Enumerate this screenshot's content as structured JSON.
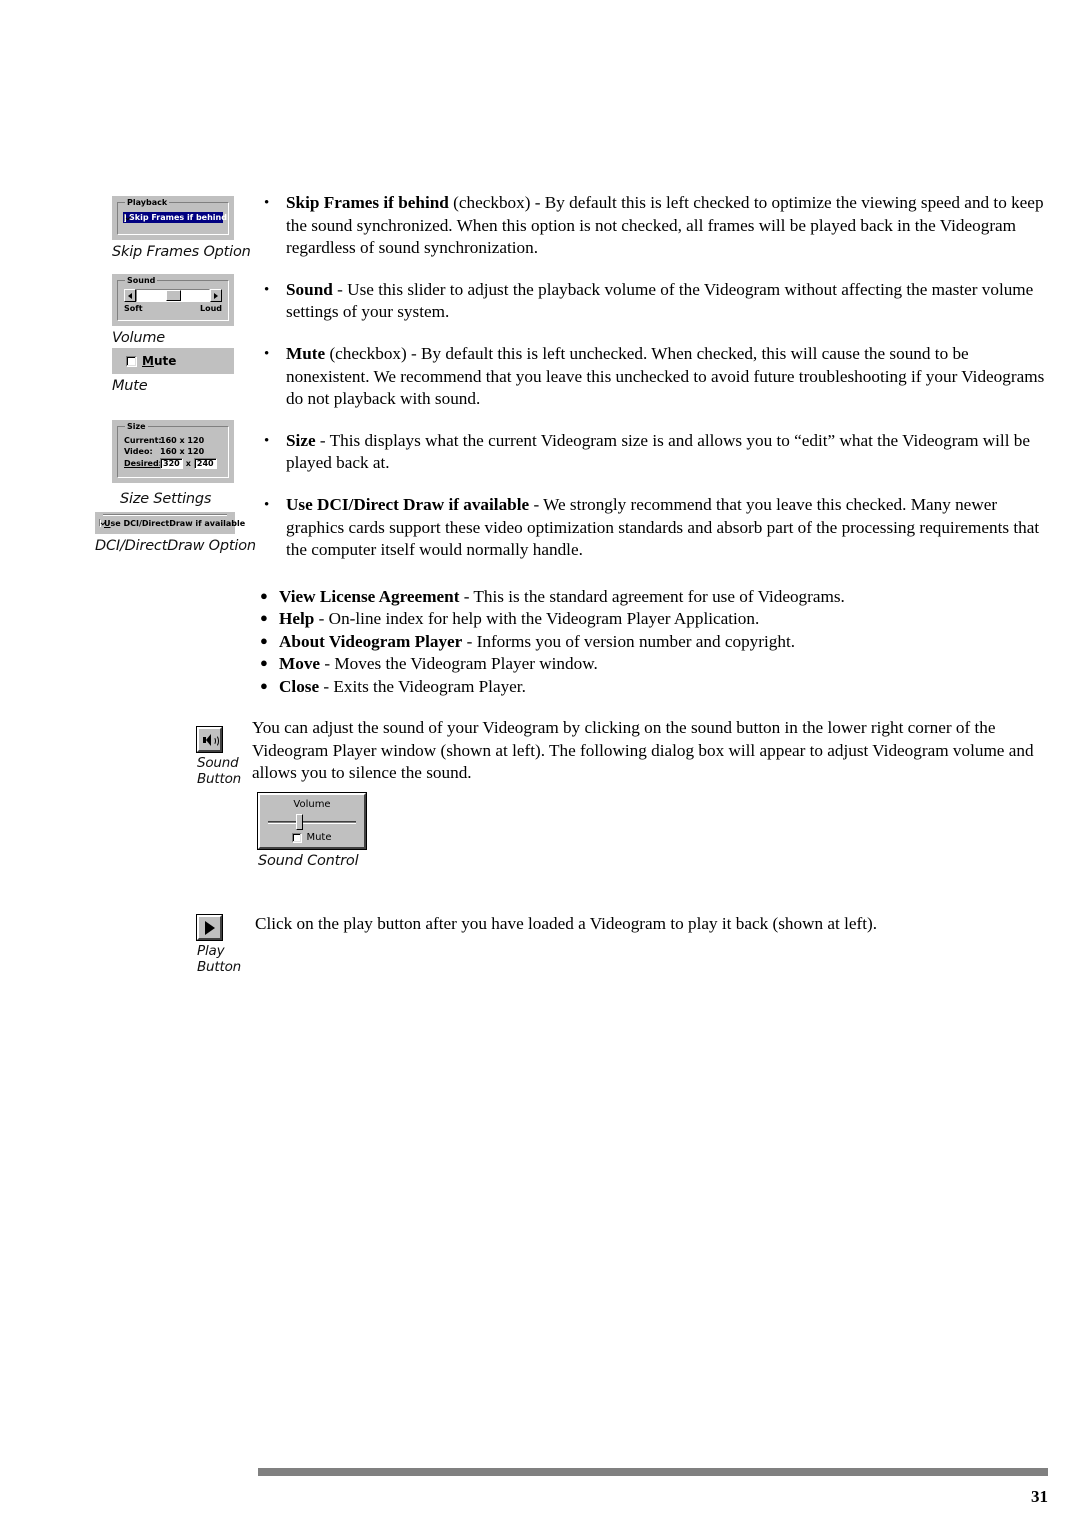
{
  "document": {
    "page_number": "31"
  },
  "figures": {
    "skip_frames": {
      "caption": "Skip Frames Option",
      "group_title": "Playback",
      "checkbox_label": "Skip Frames if behind",
      "checked": true,
      "highlight_color": "#000080"
    },
    "volume": {
      "caption": "Volume",
      "group_title": "Sound",
      "label_left": "Soft",
      "label_right": "Loud"
    },
    "mute": {
      "caption": "Mute",
      "checkbox_label_mnemonic": "M",
      "checkbox_label_rest": "ute",
      "checked": false
    },
    "size": {
      "caption": "Size Settings",
      "group_title": "Size",
      "rows": [
        {
          "label": "Current:",
          "value": "160 x 120"
        },
        {
          "label": "Video:",
          "value": "160 x 120"
        }
      ],
      "desired_label": "Desired:",
      "desired_width": "320",
      "desired_separator": "x",
      "desired_height": "240"
    },
    "dci": {
      "caption": "DCI/DirectDraw Option",
      "checkbox_label_mnemonic": "U",
      "checkbox_label_rest": "se DCI/DirectDraw if available",
      "checked": true
    },
    "sound_button": {
      "caption_line1": "Sound",
      "caption_line2": "Button",
      "icon": "speaker-icon"
    },
    "play_button": {
      "caption_line1": "Play",
      "caption_line2": "Button",
      "icon": "play-triangle-icon"
    },
    "sound_control": {
      "caption": "Sound Control",
      "title": "Volume",
      "mute_label": "Mute",
      "mute_checked": false
    }
  },
  "options_list": [
    {
      "term": "Skip Frames if behind",
      "text": " (checkbox) - By default this is left checked to optimize the viewing speed and to keep the sound synchronized. When this option is not checked, all frames will be played back in the Videogram regardless of sound synchronization."
    },
    {
      "term": "Sound",
      "text": " - Use this slider to adjust the playback volume of the Videogram without affecting the master volume settings of your system."
    },
    {
      "term": "Mute",
      "text": " (checkbox) - By default this is left unchecked. When checked, this will cause the sound to be nonexistent. We recommend that you leave this unchecked to avoid future troubleshooting if your Videograms do not playback with sound."
    },
    {
      "term": "Size",
      "text": " - This displays what the current Videogram size is and allows you to “edit” what the Videogram will be played back at."
    },
    {
      "term": "Use DCI/Direct Draw if available",
      "text": " - We strongly recommend that you leave this checked. Many newer graphics cards support these video optimization standards and absorb part of the processing requirements that the computer itself would normally handle."
    }
  ],
  "menu_list": [
    {
      "term": "View License Agreement",
      "text": " - This is the standard agreement for use of Videograms."
    },
    {
      "term": "Help",
      "text": " - On-line index for help with the Videogram Player Application."
    },
    {
      "term": "About Videogram Player",
      "text": " - Informs you of version number and copyright."
    },
    {
      "term": "Move",
      "text": " - Moves the Videogram Player window."
    },
    {
      "term": "Close",
      "text": " - Exits the Videogram Player."
    }
  ],
  "paragraphs": {
    "sound_adjust": "You can adjust the sound of your Videogram by clicking on the sound button in the lower right corner of the Videogram Player window (shown at left). The following dialog box will appear to adjust Videogram volume and allows you to silence the sound.",
    "play_back": "Click on the play button after you have loaded a Videogram to play it back (shown at left)."
  },
  "glyphs": {
    "bullet_small": "•",
    "bullet_disc": "●",
    "cross": "x"
  }
}
